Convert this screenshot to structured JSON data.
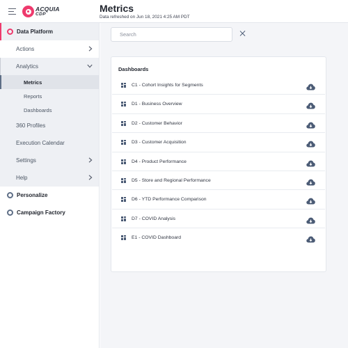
{
  "header": {
    "logo_text": "ACQUIA",
    "logo_sub": "CDP",
    "title": "Metrics",
    "refresh_text": "Data refreshed on Jun 18, 2021 4:25 AM PDT"
  },
  "sidebar": {
    "data_platform": "Data Platform",
    "actions": "Actions",
    "analytics": "Analytics",
    "analytics_sub": [
      "Metrics",
      "Reports",
      "Dashboards"
    ],
    "profiles": "360 Profiles",
    "execution_calendar": "Execution Calendar",
    "settings": "Settings",
    "help": "Help",
    "personalize": "Personalize",
    "campaign_factory": "Campaign Factory"
  },
  "search": {
    "placeholder": "Search"
  },
  "dashboards": {
    "title": "Dashboards",
    "items": [
      "C1 - Cohort Insights for Segments",
      "D1 - Business Overview",
      "D2 - Customer Behavior",
      "D3 - Customer Acquisition",
      "D4 - Product Performance",
      "D5 - Store and Regional Performance",
      "D6 - YTD Performance Comparison",
      "D7 - COVID Analysis",
      "E1 - COVID Dashboard"
    ]
  },
  "colors": {
    "brand": "#ee3a6d",
    "icon": "#4b5b75"
  }
}
